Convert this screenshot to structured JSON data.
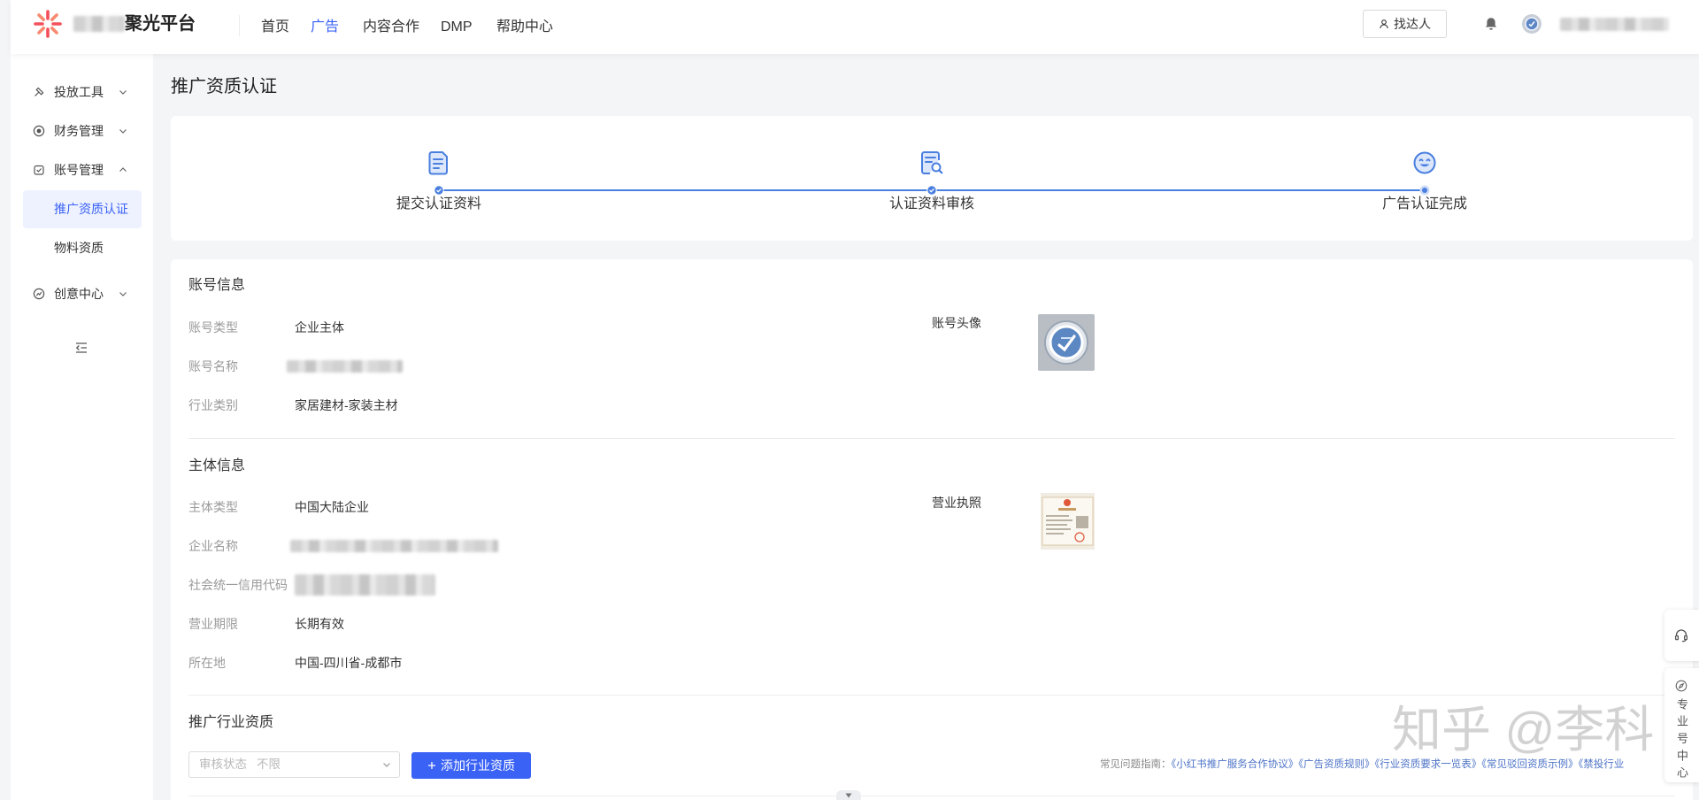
{
  "header": {
    "brand": "聚光平台",
    "nav": [
      {
        "label": "首页",
        "active": false
      },
      {
        "label": "广告",
        "active": true
      },
      {
        "label": "内容合作",
        "active": false
      },
      {
        "label": "DMP",
        "active": false
      },
      {
        "label": "帮助中心",
        "active": false
      }
    ],
    "find_talent": {
      "label": "找达人",
      "icon": "user-icon"
    },
    "notification_icon": "bell-icon",
    "user_avatar_icon": "avatar-icon",
    "user_name_redacted": true
  },
  "sidebar": {
    "items": [
      {
        "label": "投放工具",
        "icon": "tool-icon",
        "expanded": false
      },
      {
        "label": "财务管理",
        "icon": "finance-icon",
        "expanded": false
      },
      {
        "label": "账号管理",
        "icon": "account-icon",
        "expanded": true,
        "children": [
          {
            "label": "推广资质认证",
            "selected": true
          },
          {
            "label": "物料资质",
            "selected": false
          }
        ]
      },
      {
        "label": "创意中心",
        "icon": "creative-icon",
        "expanded": false
      }
    ],
    "collapse_icon": "collapse-menu-icon"
  },
  "page_title": "推广资质认证",
  "steps": [
    {
      "label": "提交认证资料",
      "icon": "document-icon",
      "completed": true
    },
    {
      "label": "认证资料审核",
      "icon": "review-icon",
      "completed": true
    },
    {
      "label": "广告认证完成",
      "icon": "smile-icon",
      "completed": false
    }
  ],
  "account_info": {
    "heading": "账号信息",
    "fields": [
      {
        "label": "账号类型",
        "value": "企业主体"
      },
      {
        "label": "账号名称",
        "redacted": true
      },
      {
        "label": "行业类别",
        "value": "家居建材-家装主材"
      }
    ],
    "avatar_label": "账号头像"
  },
  "entity_info": {
    "heading": "主体信息",
    "fields": [
      {
        "label": "主体类型",
        "value": "中国大陆企业"
      },
      {
        "label": "企业名称",
        "redacted": true
      },
      {
        "label": "社会统一信用代码",
        "redacted": true
      },
      {
        "label": "营业期限",
        "value": "长期有效"
      },
      {
        "label": "所在地",
        "value": "中国-四川省-成都市"
      }
    ],
    "license_label": "营业执照"
  },
  "industry_qualification": {
    "heading": "推广行业资质",
    "status_filter": {
      "label": "审核状态",
      "value": "不限"
    },
    "add_button": "添加行业资质",
    "guide": {
      "prefix": "常见问题指南：",
      "links": [
        "《小红书推广服务合作协议》",
        "《广告资质规则》",
        "《行业资质要求一览表》",
        "《常见驳回资质示例》",
        "《禁投行业"
      ]
    }
  },
  "floating_tools": {
    "service_icon": "headset-icon",
    "pro_center": {
      "icon": "compass-icon",
      "label": "专业号中心"
    }
  },
  "watermark": "知乎 @李科",
  "colors": {
    "accent": "#3a62f5",
    "step": "#4a7fe0",
    "link": "#4d73c7",
    "page_bg": "#f4f5f7"
  }
}
